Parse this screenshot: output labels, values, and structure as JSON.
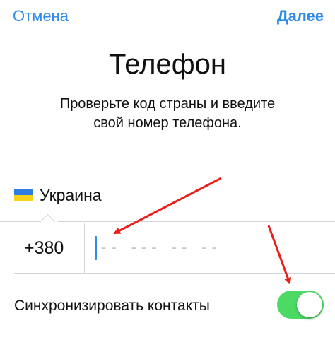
{
  "nav": {
    "cancel_label": "Отмена",
    "next_label": "Далее"
  },
  "header": {
    "title": "Телефон",
    "subtitle_line1": "Проверьте код страны и введите",
    "subtitle_line2": "свой номер телефона."
  },
  "country": {
    "name": "Украина",
    "flag_icon": "ukraine-flag-icon",
    "flag_colors": [
      "#2f7de1",
      "#f7d21b"
    ]
  },
  "phone": {
    "country_code": "+380",
    "placeholder": "-- --- -- --",
    "value": ""
  },
  "sync": {
    "label": "Синхронизировать контакты",
    "enabled": true
  },
  "colors": {
    "accent": "#2f8be6",
    "toggle_on": "#4cd964",
    "annotation_arrow": "#e8201c"
  }
}
